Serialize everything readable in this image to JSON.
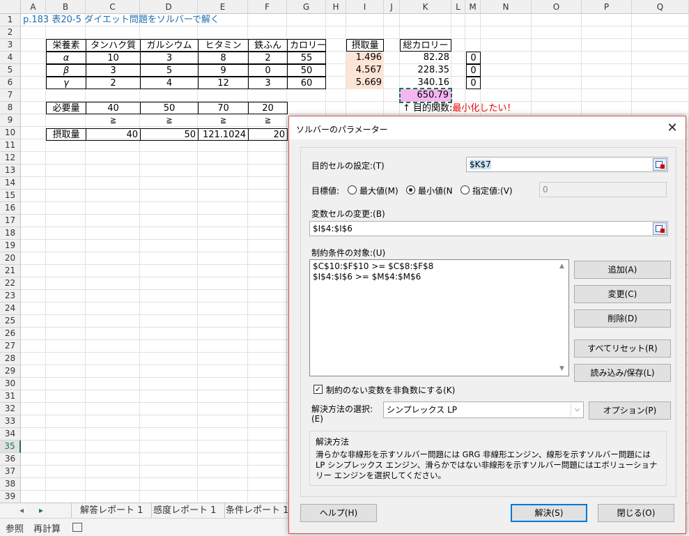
{
  "sheet": {
    "columns": [
      "A",
      "B",
      "C",
      "D",
      "E",
      "F",
      "G",
      "H",
      "I",
      "J",
      "K",
      "L",
      "M",
      "N",
      "O",
      "P",
      "Q"
    ],
    "rows": [
      "1",
      "2",
      "3",
      "4",
      "5",
      "6",
      "7",
      "8",
      "9",
      "10",
      "11",
      "12",
      "13",
      "14",
      "15",
      "16",
      "17",
      "18",
      "19",
      "20",
      "21",
      "22",
      "23",
      "24",
      "25",
      "26",
      "27",
      "28",
      "29",
      "30",
      "31",
      "32",
      "33",
      "34",
      "35",
      "36",
      "37",
      "38",
      "39"
    ],
    "title": "p.183 表20-5 ダイエット問題をソルバーで解く",
    "headers": {
      "nutrient": "栄養素",
      "protein": "タンハク質",
      "calcium": "ガルシウム",
      "vitamin": "ヒタミン",
      "iron": "鉄ふん",
      "calorie": "カロリー",
      "intake": "摂取量",
      "total_calorie": "総カロリー"
    },
    "foods": [
      {
        "name": "α",
        "protein": "10",
        "calcium": "3",
        "vitamin": "8",
        "iron": "2",
        "calorie": "55",
        "intake": "1.496",
        "total": "82.28",
        "min": "0"
      },
      {
        "name": "β",
        "protein": "3",
        "calcium": "5",
        "vitamin": "9",
        "iron": "0",
        "calorie": "50",
        "intake": "4.567",
        "total": "228.35",
        "min": "0"
      },
      {
        "name": "γ",
        "protein": "2",
        "calcium": "4",
        "vitamin": "12",
        "iron": "3",
        "calorie": "60",
        "intake": "5.669",
        "total": "340.16",
        "min": "0"
      }
    ],
    "objective_value": "650.79",
    "objective_note_prefix": "↑ 目的関数:",
    "objective_note_red": "最小化したい！",
    "required": {
      "label": "必要量",
      "protein": "40",
      "calcium": "50",
      "vitamin": "70",
      "iron": "20"
    },
    "ge_symbol": "≧",
    "intake_row": {
      "label": "摂取量",
      "protein": "40",
      "calcium": "50",
      "vitamin": "121.1024",
      "iron": "20"
    }
  },
  "tabs": {
    "items": [
      "解答レポート 1",
      "感度レポート 1",
      "条件レポート 1"
    ]
  },
  "status": {
    "ref": "参照",
    "recalc": "再計算"
  },
  "dialog": {
    "title": "ソルバーのパラメーター",
    "objective_label": "目的セルの設定:(T)",
    "objective_value": "$K$7",
    "target_label": "目標値:",
    "opt_max": "最大値(M)",
    "opt_min": "最小値(N",
    "opt_value": "指定値:(V)",
    "value_field": "0",
    "variable_label": "変数セルの変更:(B)",
    "variable_value": "$I$4:$I$6",
    "constraints_label": "制約条件の対象:(U)",
    "constraints": [
      "$C$10:$F$10 >= $C$8:$F$8",
      "$I$4:$I$6 >= $M$4:$M$6"
    ],
    "btn_add": "追加(A)",
    "btn_change": "変更(C)",
    "btn_delete": "削除(D)",
    "btn_reset": "すべてリセット(R)",
    "btn_load": "読み込み/保存(L)",
    "nonneg_label": "制約のない変数を非負数にする(K)",
    "method_label_1": "解決方法の選択:",
    "method_label_2": "(E)",
    "method_value": "シンプレックス LP",
    "btn_options": "オプション(P)",
    "method_group_title": "解決方法",
    "method_desc": "滑らかな非線形を示すソルバー問題には GRG 非線形エンジン、線形を示すソルバー問題には LP シンプレックス エンジン、滑らかではない非線形を示すソルバー問題にはエボリューショナリー エンジンを選択してください。",
    "btn_help": "ヘルプ(H)",
    "btn_solve": "解決(S)",
    "btn_close": "閉じる(O)"
  }
}
